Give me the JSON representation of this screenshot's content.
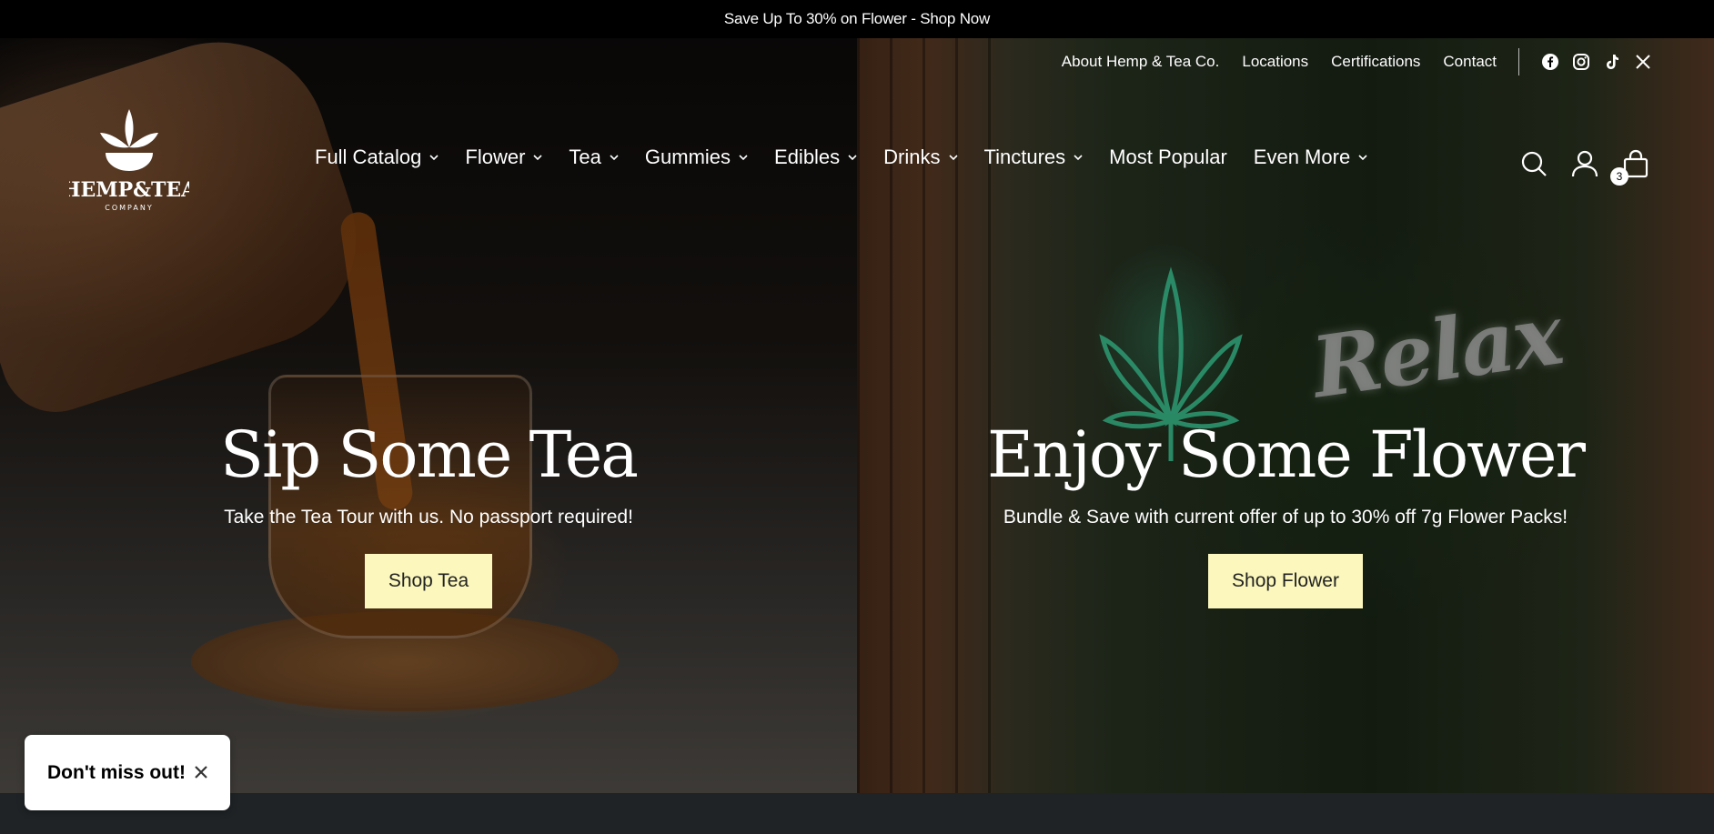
{
  "announcement": {
    "text": "Save Up To 30% on Flower - Shop Now"
  },
  "utility_nav": {
    "links": [
      "About Hemp & Tea Co.",
      "Locations",
      "Certifications",
      "Contact"
    ],
    "social_icons": [
      "facebook-icon",
      "instagram-icon",
      "tiktok-icon",
      "x-icon"
    ]
  },
  "logo": {
    "line1": "HEMP&TEA",
    "line2": "COMPANY"
  },
  "main_nav": {
    "items": [
      {
        "label": "Full Catalog",
        "has_dropdown": true
      },
      {
        "label": "Flower",
        "has_dropdown": true
      },
      {
        "label": "Tea",
        "has_dropdown": true
      },
      {
        "label": "Gummies",
        "has_dropdown": true
      },
      {
        "label": "Edibles",
        "has_dropdown": true
      },
      {
        "label": "Drinks",
        "has_dropdown": true
      },
      {
        "label": "Tinctures",
        "has_dropdown": true
      },
      {
        "label": "Most Popular",
        "has_dropdown": false
      },
      {
        "label": "Even More",
        "has_dropdown": true
      }
    ]
  },
  "tools": {
    "cart_count": "3",
    "icons": [
      "search-icon",
      "account-icon",
      "cart-icon"
    ]
  },
  "hero": {
    "left": {
      "title": "Sip Some Tea",
      "subtitle": "Take the Tea Tour with us. No passport required!",
      "button": "Shop Tea"
    },
    "right": {
      "title": "Enjoy Some Flower",
      "subtitle": "Bundle & Save with current offer of up to 30% off 7g Flower Packs!",
      "button": "Shop Flower",
      "neon_text": "Relax"
    }
  },
  "popup": {
    "text": "Don't miss out!"
  },
  "colors": {
    "button_bg": "#fbf7bd",
    "announcement_bg": "#000000",
    "neon_green": "#3fd6a0"
  }
}
